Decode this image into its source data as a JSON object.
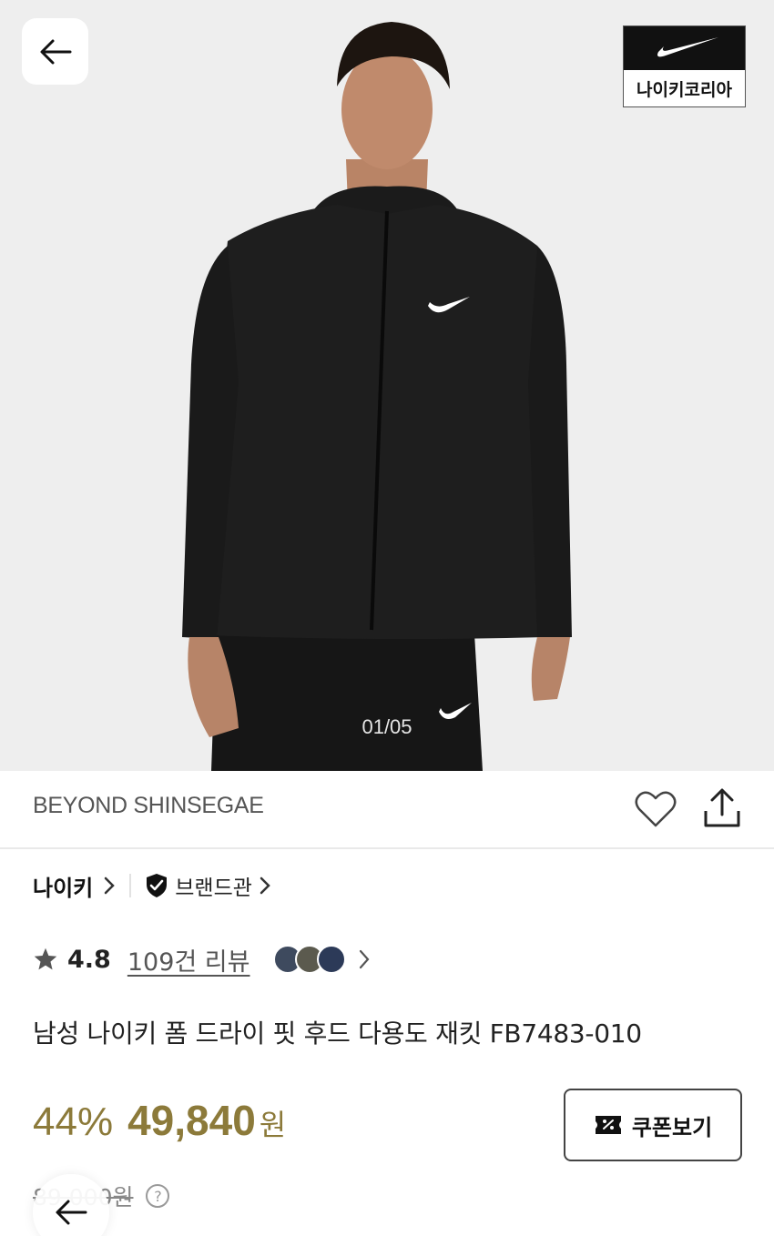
{
  "hero": {
    "image_alt": "product-photo",
    "counter": "01/05",
    "badge_label": "나이키코리아"
  },
  "store": {
    "name": "BEYOND SHINSEGAE"
  },
  "brand": {
    "name": "나이키",
    "shop_label": "브랜드관"
  },
  "rating": {
    "value": "4.8",
    "review_link": "109건 리뷰"
  },
  "product": {
    "title": "남성 나이키 폼 드라이 핏 후드 다용도 재킷 FB7483-010",
    "discount": "44%",
    "price": "49,840",
    "currency": "원",
    "original_price": "89,000원"
  },
  "buttons": {
    "coupon_label": "쿠폰보기",
    "help": "?"
  },
  "colors": {
    "accent": "#8c7a3a",
    "hero_bg": "#eeeeee"
  }
}
